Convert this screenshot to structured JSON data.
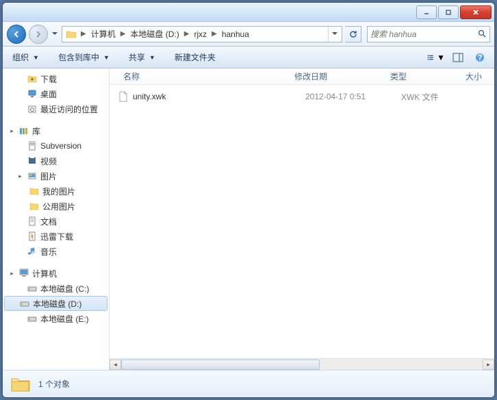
{
  "breadcrumb": {
    "segments": [
      "计算机",
      "本地磁盘 (D:)",
      "rjxz",
      "hanhua"
    ]
  },
  "search": {
    "placeholder": "搜索 hanhua"
  },
  "toolbar": {
    "organize": "组织",
    "include": "包含到库中",
    "share": "共享",
    "new_folder": "新建文件夹"
  },
  "sidebar": {
    "downloads": "下载",
    "desktop": "桌面",
    "recent": "最近访问的位置",
    "libraries": "库",
    "subversion": "Subversion",
    "videos": "视频",
    "pictures": "图片",
    "my_pictures": "我的图片",
    "public_pictures": "公用图片",
    "documents": "文档",
    "xunlei": "迅雷下载",
    "music": "音乐",
    "computer": "计算机",
    "drive_c": "本地磁盘 (C:)",
    "drive_d": "本地磁盘 (D:)",
    "drive_e": "本地磁盘 (E:)"
  },
  "columns": {
    "name": "名称",
    "date": "修改日期",
    "type": "类型",
    "size": "大小"
  },
  "files": [
    {
      "name": "unity.xwk",
      "date": "2012-04-17 0:51",
      "type": "XWK 文件"
    }
  ],
  "statusbar": {
    "count": "1 个对象"
  }
}
